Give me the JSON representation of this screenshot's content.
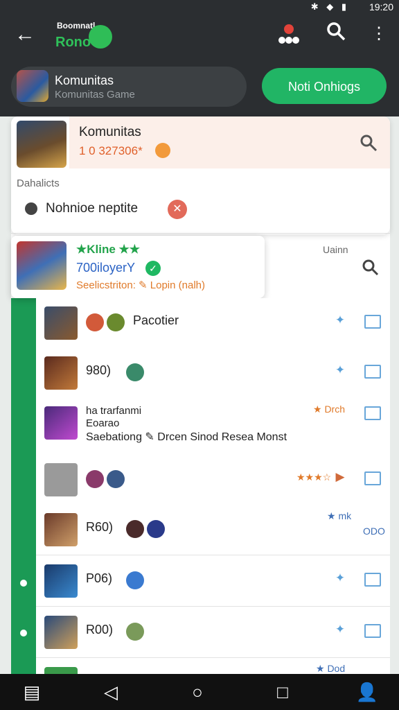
{
  "status": {
    "time": "19:20",
    "icons": "✱ ◆ ▮"
  },
  "header": {
    "logo_top": "Boomnatl",
    "logo_main": "Rono",
    "game_title": "Komunitas",
    "game_sub": "Komunitas Game",
    "noti_button": "Noti Onhiogs"
  },
  "profile_card": {
    "name": "Komunitas",
    "score": "1 0 327306*",
    "section": "Dahalicts",
    "notification": "Nohnioe neptite"
  },
  "popup": {
    "line1": "★Kline ★★",
    "line2": "700iloyerY",
    "line3": "Seelicstriton: ✎ Lopin (nalh)"
  },
  "side": {
    "label": "Uainn"
  },
  "rows": [
    {
      "label": "Pacotier",
      "meta": ""
    },
    {
      "label": "980)",
      "meta": ""
    },
    {
      "long1": "ha trarfanmi",
      "long2": "Eoarao",
      "long3": "Saebationg ✎ Drcen Sinod Resea Monst",
      "meta": "★ Drch"
    },
    {
      "label": "",
      "meta": "★★★☆"
    },
    {
      "label": "R60)",
      "meta": "★ mk",
      "extra": "ODO"
    },
    {
      "label": "P06)",
      "meta": ""
    },
    {
      "label": "R00)",
      "meta": ""
    },
    {
      "label": "",
      "meta": "★ Dod"
    }
  ],
  "colors": {
    "accent_green": "#21b565",
    "dark_bar": "#2b2e31",
    "link_blue": "#2a62c4"
  }
}
